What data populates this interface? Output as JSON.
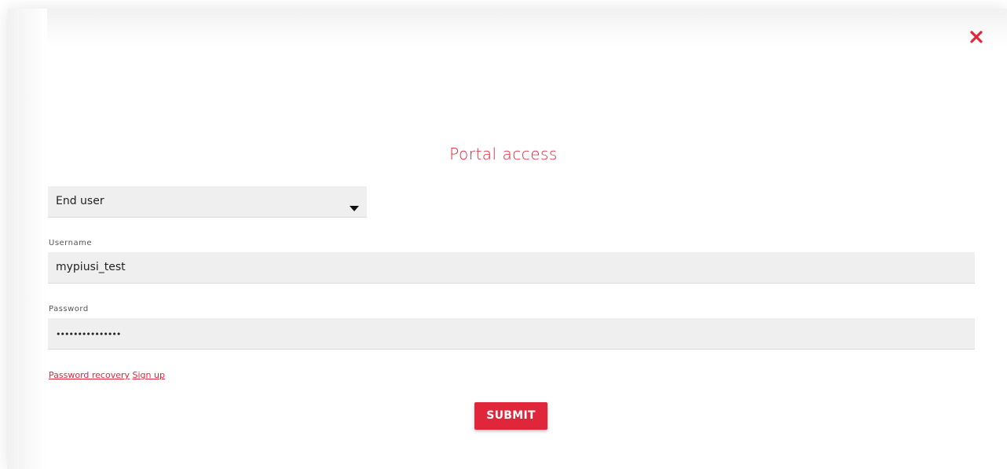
{
  "colors": {
    "accent": "#e0263a",
    "field_bg": "#efefef"
  },
  "dialog": {
    "title": "Portal access",
    "close_icon": "close-icon"
  },
  "role_select": {
    "selected": "End user",
    "icon": "caret-down-icon"
  },
  "username": {
    "label": "Username",
    "value": "mypiusi_test"
  },
  "password": {
    "label": "Password",
    "value": "•••••••••••••••"
  },
  "links": {
    "password_recovery": "Password recovery",
    "sign_up": "Sign up"
  },
  "submit_label": "SUBMIT"
}
